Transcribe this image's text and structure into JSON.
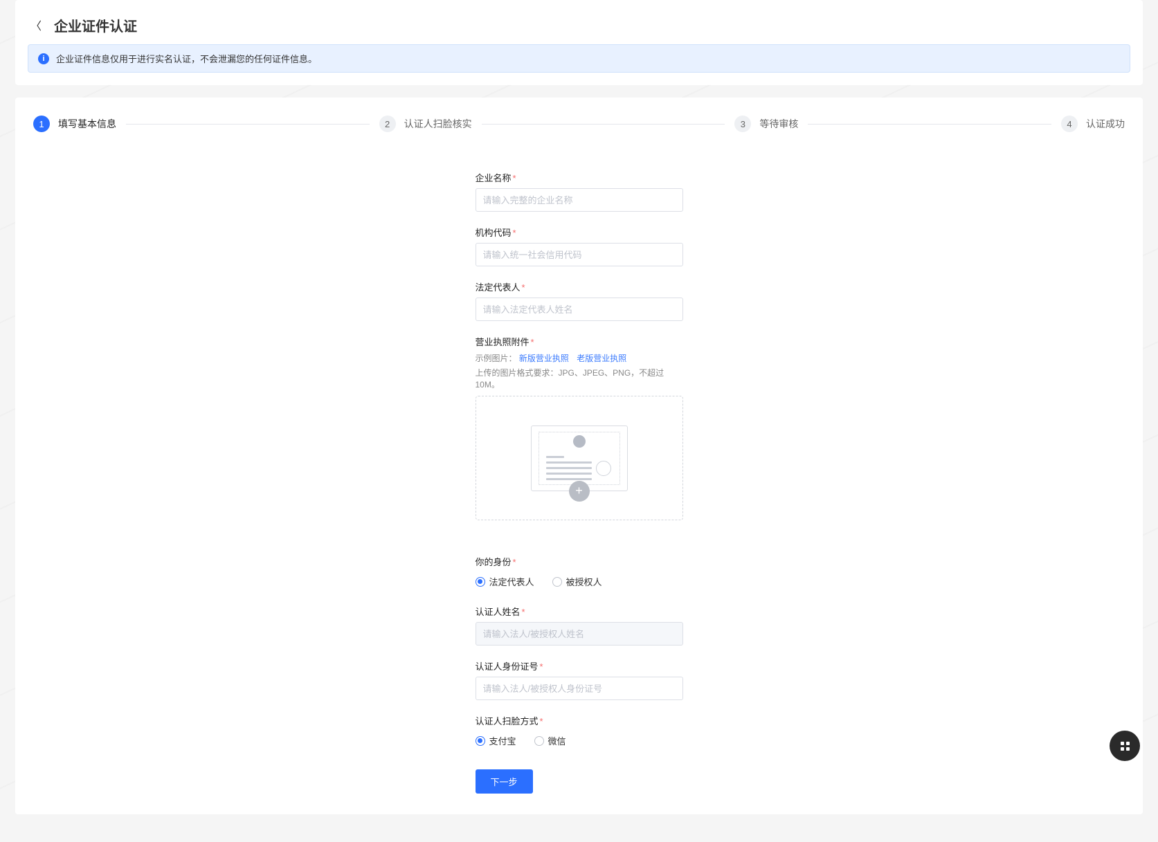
{
  "header": {
    "title": "企业证件认证",
    "banner": "企业证件信息仅用于进行实名认证，不会泄漏您的任何证件信息。"
  },
  "steps": [
    {
      "num": "1",
      "label": "填写基本信息",
      "active": true
    },
    {
      "num": "2",
      "label": "认证人扫脸核实",
      "active": false
    },
    {
      "num": "3",
      "label": "等待审核",
      "active": false
    },
    {
      "num": "4",
      "label": "认证成功",
      "active": false
    }
  ],
  "form": {
    "company_name": {
      "label": "企业名称",
      "placeholder": "请输入完整的企业名称"
    },
    "org_code": {
      "label": "机构代码",
      "placeholder": "请输入统一社会信用代码"
    },
    "legal_rep": {
      "label": "法定代表人",
      "placeholder": "请输入法定代表人姓名"
    },
    "license": {
      "label": "营业执照附件",
      "sample_prefix": "示例图片：",
      "sample_new": "新版营业执照",
      "sample_old": "老版营业执照",
      "hint": "上传的图片格式要求：JPG、JPEG、PNG，不超过10M。"
    },
    "identity": {
      "label": "你的身份",
      "option_legal": "法定代表人",
      "option_auth": "被授权人",
      "selected": "legal"
    },
    "verifier_name": {
      "label": "认证人姓名",
      "placeholder": "请输入法人/被授权人姓名"
    },
    "verifier_id": {
      "label": "认证人身份证号",
      "placeholder": "请输入法人/被授权人身份证号"
    },
    "scan_method": {
      "label": "认证人扫脸方式",
      "option_alipay": "支付宝",
      "option_wechat": "微信",
      "selected": "alipay"
    },
    "submit": "下一步"
  }
}
